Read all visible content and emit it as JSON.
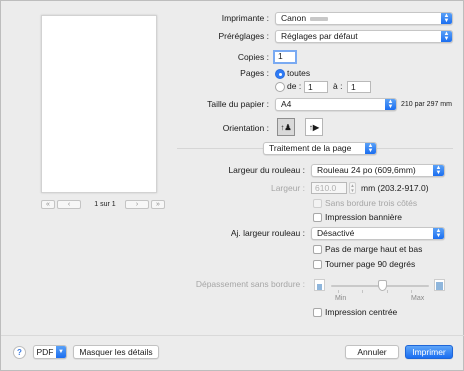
{
  "printer": {
    "label": "Imprimante :",
    "value": "Canon"
  },
  "presets": {
    "label": "Préréglages :",
    "value": "Réglages par défaut"
  },
  "copies": {
    "label": "Copies :",
    "value": "1"
  },
  "pages": {
    "label": "Pages :",
    "all_label": "toutes",
    "from_label": "de :",
    "from_value": "1",
    "to_label": "à :",
    "to_value": "1"
  },
  "paper_size": {
    "label": "Taille du papier :",
    "value": "A4",
    "dims": "210 par 297 mm"
  },
  "orientation": {
    "label": "Orientation :",
    "portrait_glyph": "↑♟",
    "landscape_glyph": "↑▶"
  },
  "preview_nav": {
    "first": "«",
    "prev": "‹",
    "page_text": "1 sur 1",
    "next": "›",
    "last": "»"
  },
  "section_popup": {
    "value": "Traitement de la page"
  },
  "roll_width": {
    "label": "Largeur du rouleau :",
    "value": "Rouleau 24 po (609,6mm)"
  },
  "width": {
    "label": "Largeur :",
    "value": "610.0",
    "unit": "mm (203.2-917.0)"
  },
  "borderless_three": {
    "label": "Sans bordure trois côtés"
  },
  "banner_print": {
    "label": "Impression bannière"
  },
  "fit_roll": {
    "label": "Aj. largeur rouleau :",
    "value": "Désactivé"
  },
  "no_margin": {
    "label": "Pas de marge haut et bas"
  },
  "rotate_90": {
    "label": "Tourner page 90 degrés"
  },
  "overflow": {
    "label": "Dépassement sans bordure :",
    "min": "Min",
    "max": "Max",
    "level": 0.5
  },
  "center_print": {
    "label": "Impression centrée"
  },
  "footer": {
    "help": "?",
    "pdf": "PDF",
    "hide_details": "Masquer les détails",
    "cancel": "Annuler",
    "print": "Imprimer"
  },
  "colors": {
    "accent": "#1a6ef1",
    "dialog_bg": "#ececec"
  }
}
